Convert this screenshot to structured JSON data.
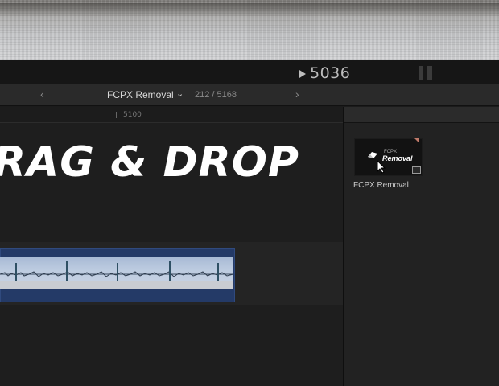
{
  "viewer": {
    "timecode": "5036",
    "play_icon": "play-icon",
    "pause_icon": "pause-icon"
  },
  "timeline_nav": {
    "back_icon": "chevron-left-icon",
    "forward_icon": "chevron-right-icon",
    "project_title": "FCPX Removal",
    "project_chevron": "⌄",
    "position_counter": "212 / 5168",
    "back_glyph": "‹",
    "forward_glyph": "›"
  },
  "timeline": {
    "ruler_label": "5100",
    "title_clip_text": "RAG & DROP",
    "audio_clip_color": "#243a67"
  },
  "browser": {
    "thumbnail": {
      "label_small": "FCPX",
      "label_big": "Removal"
    },
    "clip_name": "FCPX Removal"
  }
}
